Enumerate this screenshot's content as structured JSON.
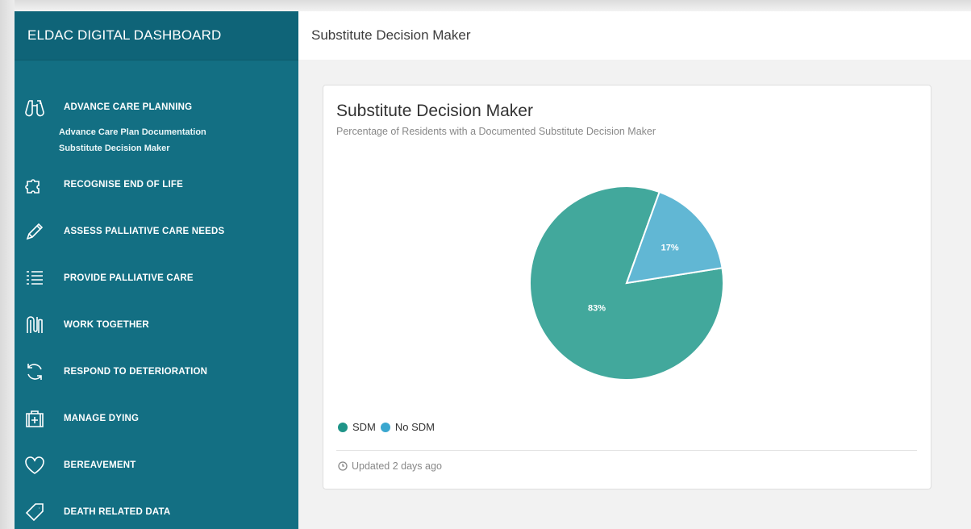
{
  "app": {
    "title": "ELDAC DIGITAL DASHBOARD"
  },
  "header": {
    "title": "Substitute Decision Maker"
  },
  "sidebar": {
    "items": [
      {
        "label": "ADVANCE CARE PLANNING",
        "icon": "binoculars-icon",
        "children": [
          "Advance Care Plan Documentation",
          "Substitute Decision Maker"
        ]
      },
      {
        "label": "RECOGNISE END OF LIFE",
        "icon": "puzzle-icon"
      },
      {
        "label": "ASSESS PALLIATIVE CARE NEEDS",
        "icon": "pencil-icon"
      },
      {
        "label": "PROVIDE PALLIATIVE CARE",
        "icon": "list-icon"
      },
      {
        "label": "WORK TOGETHER",
        "icon": "linked-hands-icon"
      },
      {
        "label": "RESPOND TO DETERIORATION",
        "icon": "refresh-icon"
      },
      {
        "label": "MANAGE DYING",
        "icon": "medical-kit-icon"
      },
      {
        "label": "BEREAVEMENT",
        "icon": "heart-icon"
      },
      {
        "label": "DEATH RELATED DATA",
        "icon": "tag-icon"
      }
    ]
  },
  "card": {
    "title": "Substitute Decision Maker",
    "subtitle": "Percentage of Residents with a Documented Substitute Decision Maker",
    "updated": "Updated 2 days ago"
  },
  "colors": {
    "sidebar": "#136f83",
    "sdm": "#42a89c",
    "no_sdm": "#61b7d4"
  },
  "chart_data": {
    "type": "pie",
    "categories": [
      "SDM",
      "No SDM"
    ],
    "values": [
      83,
      17
    ],
    "labels": [
      "83%",
      "17%"
    ],
    "colors": [
      "#42a89c",
      "#61b7d4"
    ],
    "legend": "bottom-left"
  }
}
